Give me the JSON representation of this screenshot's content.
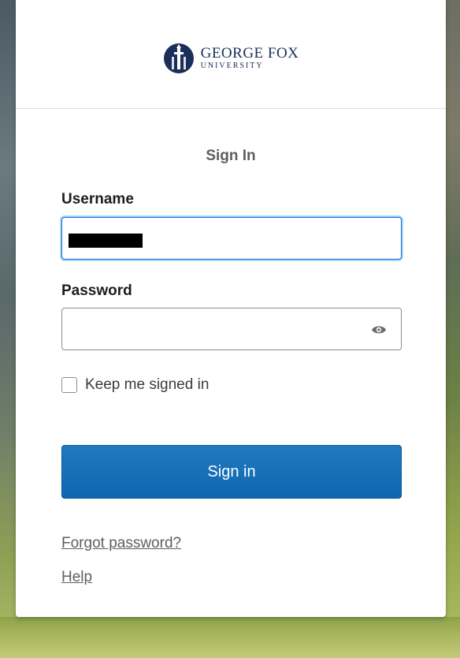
{
  "brand": {
    "name": "GEORGE FOX",
    "sub": "UNIVERSITY",
    "color": "#1a2e5a"
  },
  "form": {
    "title": "Sign In",
    "username_label": "Username",
    "username_value": "",
    "password_label": "Password",
    "password_value": "",
    "keep_signed_in_label": "Keep me signed in",
    "keep_signed_in_checked": false,
    "submit_label": "Sign in",
    "submit_color": "#0f66b0"
  },
  "links": {
    "forgot_password": "Forgot password?",
    "help": "Help"
  },
  "icons": {
    "logo": "george-fox-logo-icon",
    "password_toggle": "eye-icon"
  }
}
